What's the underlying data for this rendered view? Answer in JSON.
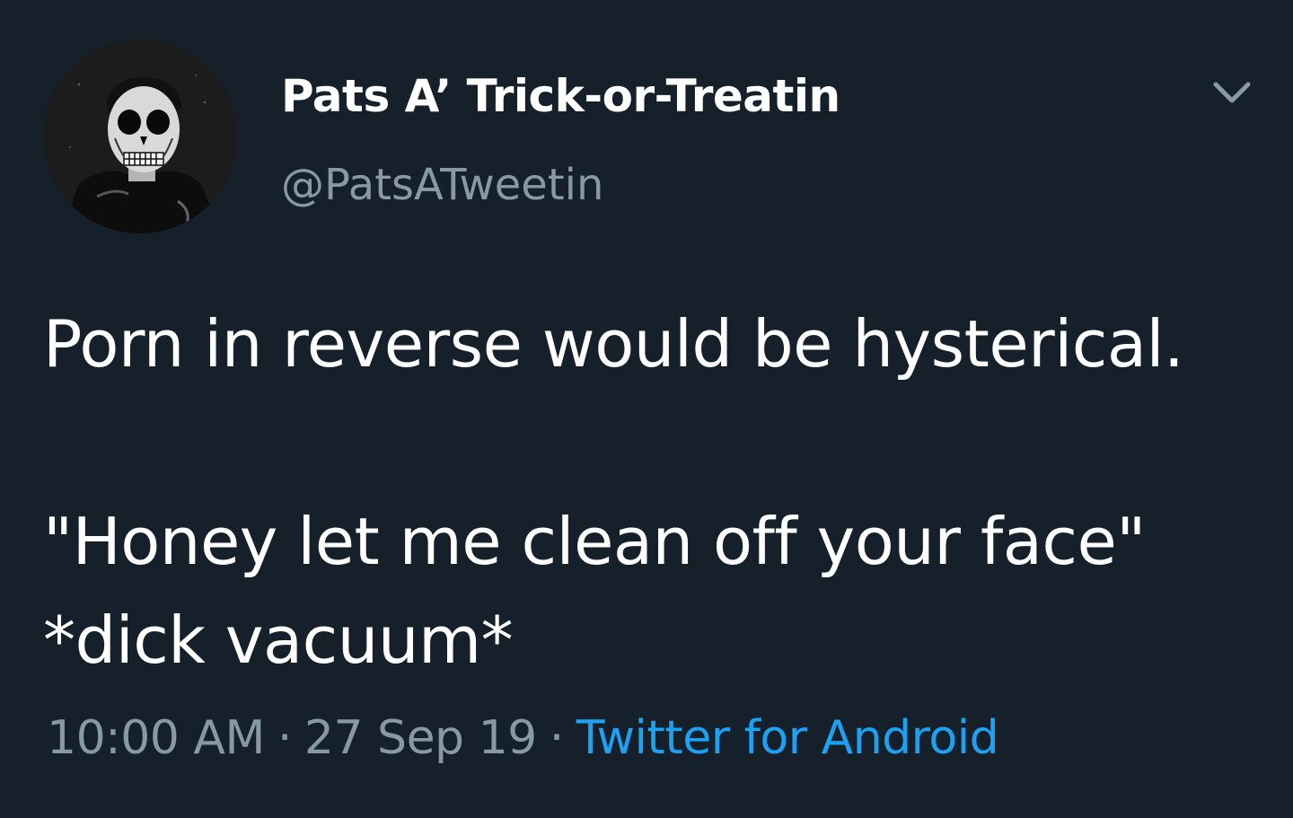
{
  "tweet": {
    "display_name": "Pats A’ Trick-or-Treatin",
    "handle": "@PatsATweetin",
    "text": "Porn in reverse would be hysterical.\n\n\"Honey let me clean off your face\"\n*dick vacuum*",
    "time": "10:00 AM",
    "separator": "·",
    "date": "27 Sep 19",
    "source": "Twitter for Android",
    "avatar_icon": "skull-face-avatar",
    "menu_icon": "chevron-down-icon"
  },
  "colors": {
    "background": "#15202b",
    "primary_text": "#ffffff",
    "secondary_text": "#8899a6",
    "link": "#1da1f2"
  }
}
